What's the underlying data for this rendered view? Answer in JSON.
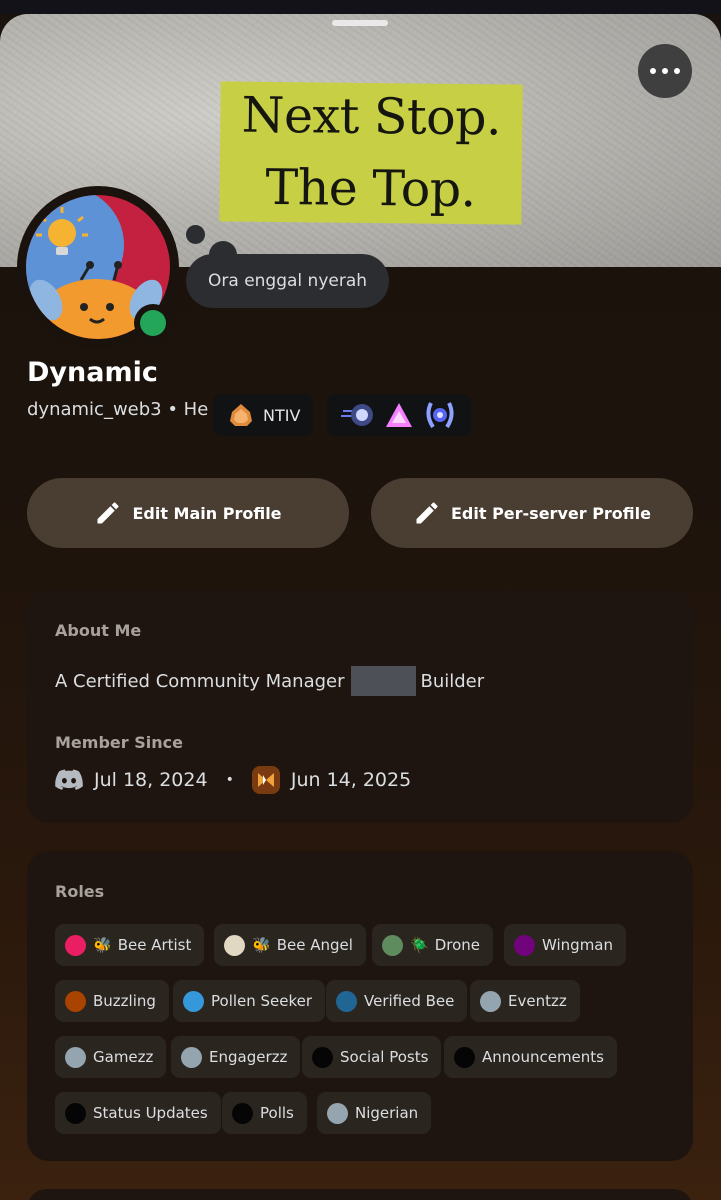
{
  "banner": {
    "line1": "Next Stop.",
    "line2": "The Top."
  },
  "status_text": "Ora enggal nyerah",
  "profile": {
    "display_name": "Dynamic",
    "username_line": "dynamic_web3 • He",
    "server_tag": "NTIV",
    "status_color": "#23a55a"
  },
  "buttons": {
    "edit_main": "Edit Main Profile",
    "edit_server": "Edit Per-server Profile"
  },
  "about": {
    "heading": "About Me",
    "text_before": "A Certified Community Manager",
    "text_after": "Builder",
    "member_since_heading": "Member Since",
    "discord_date": "Jul 18, 2024",
    "separator": "•",
    "server_date": "Jun 14, 2025"
  },
  "roles": {
    "heading": "Roles",
    "items": [
      {
        "name": "Bee Artist",
        "color": "#e91e63",
        "emoji": "🐝"
      },
      {
        "name": "Bee Angel",
        "color": "#e0d8c3",
        "emoji": "🐝"
      },
      {
        "name": "Drone",
        "color": "#5f8c5f",
        "emoji": "🪲"
      },
      {
        "name": "Wingman",
        "color": "#71037c",
        "emoji": ""
      },
      {
        "name": "Buzzling",
        "color": "#a84300",
        "emoji": ""
      },
      {
        "name": "Pollen Seeker",
        "color": "#3498db",
        "emoji": ""
      },
      {
        "name": "Verified Bee",
        "color": "#206694",
        "emoji": ""
      },
      {
        "name": "Eventzz",
        "color": "#95a5b0",
        "emoji": ""
      },
      {
        "name": "Gamezz",
        "color": "#95a5b0",
        "emoji": ""
      },
      {
        "name": "Engagerzz",
        "color": "#95a5b0",
        "emoji": ""
      },
      {
        "name": "Social Posts",
        "color": "#050505",
        "emoji": ""
      },
      {
        "name": "Announcements",
        "color": "#050505",
        "emoji": ""
      },
      {
        "name": "Status Updates",
        "color": "#050505",
        "emoji": ""
      },
      {
        "name": "Polls",
        "color": "#050505",
        "emoji": ""
      },
      {
        "name": "Nigerian",
        "color": "#95a5b0",
        "emoji": ""
      }
    ]
  },
  "icons": {
    "more": "more-dots-icon",
    "edit": "pencil-icon",
    "discord": "discord-logo-icon",
    "server": "server-icon"
  }
}
